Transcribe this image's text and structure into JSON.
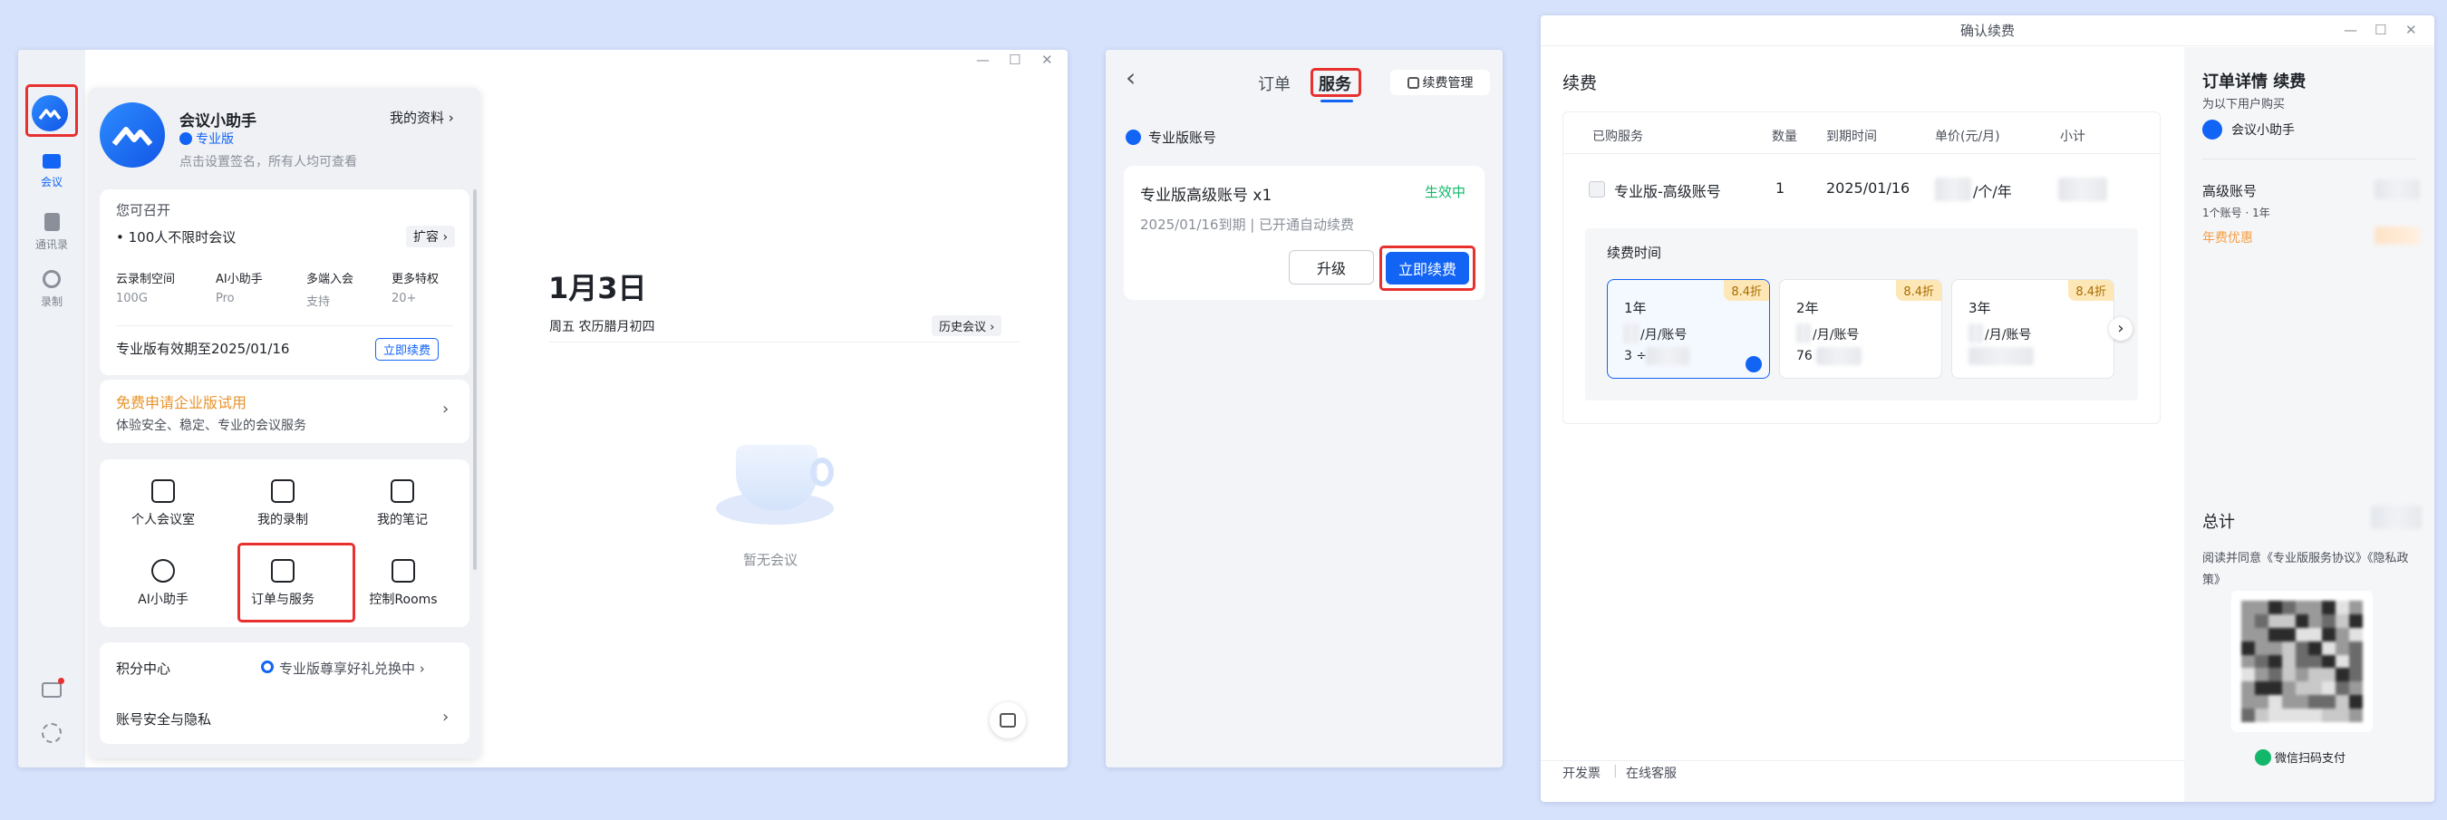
{
  "win1": {
    "nav": {
      "meeting": "会议",
      "contacts": "通讯录",
      "record": "录制"
    },
    "profile": {
      "name": "会议小助手",
      "my_profile": "我的资料 ›",
      "badge": "专业版",
      "signature": "点击设置签名，所有人均可查看"
    },
    "can_host": {
      "title": "您可召开",
      "meeting": "100人不限时会议",
      "expand": "扩容 ›",
      "features": [
        {
          "label": "云录制空间",
          "value": "100G"
        },
        {
          "label": "AI小助手",
          "value": "Pro"
        },
        {
          "label": "多端入会",
          "value": "支持"
        },
        {
          "label": "更多特权",
          "value": "20+"
        }
      ],
      "expiry": "专业版有效期至2025/01/16",
      "renew": "立即续费"
    },
    "trial": {
      "title": "免费申请企业版试用",
      "subtitle": "体验安全、稳定、专业的会议服务"
    },
    "grid": [
      "个人会议室",
      "我的录制",
      "我的笔记",
      "AI小助手",
      "订单与服务",
      "控制Rooms"
    ],
    "points": {
      "label": "积分中心",
      "promo": "专业版尊享好礼兑换中 ›"
    },
    "security": {
      "label": "账号安全与隐私"
    },
    "main": {
      "date": "1月3日",
      "subdate": "周五 农历腊月初四",
      "history": "历史会议 ›",
      "empty": "暂无会议"
    },
    "controls": {
      "min": "—",
      "max": "☐",
      "close": "✕"
    }
  },
  "win2": {
    "back": "‹",
    "tab_orders": "订单",
    "tab_services": "服务",
    "renew_manage": "续费管理",
    "section": "专业版账号",
    "account": {
      "title": "专业版高级账号 x1",
      "status": "生效中",
      "detail": "2025/01/16到期 | 已开通自动续费",
      "upgrade": "升级",
      "renew": "立即续费"
    }
  },
  "win3": {
    "title": "确认续费",
    "controls": {
      "min": "—",
      "max": "☐",
      "close": "✕"
    },
    "left": {
      "heading": "续费",
      "cols": [
        "已购服务",
        "数量",
        "到期时间",
        "单价(元/月)",
        "小计"
      ],
      "row": {
        "service": "专业版-高级账号",
        "qty": "1",
        "expire": "2025/01/16",
        "unit_suffix": "/个/年"
      },
      "duration_label": "续费时间",
      "options": [
        {
          "title": "1年",
          "discount": "8.4折",
          "per": "/月/账号",
          "total_prefix": "3 ÷"
        },
        {
          "title": "2年",
          "discount": "8.4折",
          "per": "/月/账号",
          "total_prefix": "76"
        },
        {
          "title": "3年",
          "discount": "8.4折",
          "per": "/月/账号",
          "total_prefix": ""
        }
      ],
      "footer_invoice": "开发票",
      "footer_service": "在线客服"
    },
    "right": {
      "heading": "订单详情 续费",
      "sub": "为以下用户购买",
      "user": "会议小助手",
      "item": "高级账号",
      "item_desc": "1个账号 · 1年",
      "discount": "年费优惠",
      "total": "总计",
      "agree": "阅读并同意《专业版服务协议》《隐私政策》",
      "pay": "微信扫码支付"
    }
  },
  "colors": {
    "accent": "#1264f5",
    "red": "#e8302f",
    "green": "#12b76a",
    "orange": "#f5a623"
  }
}
